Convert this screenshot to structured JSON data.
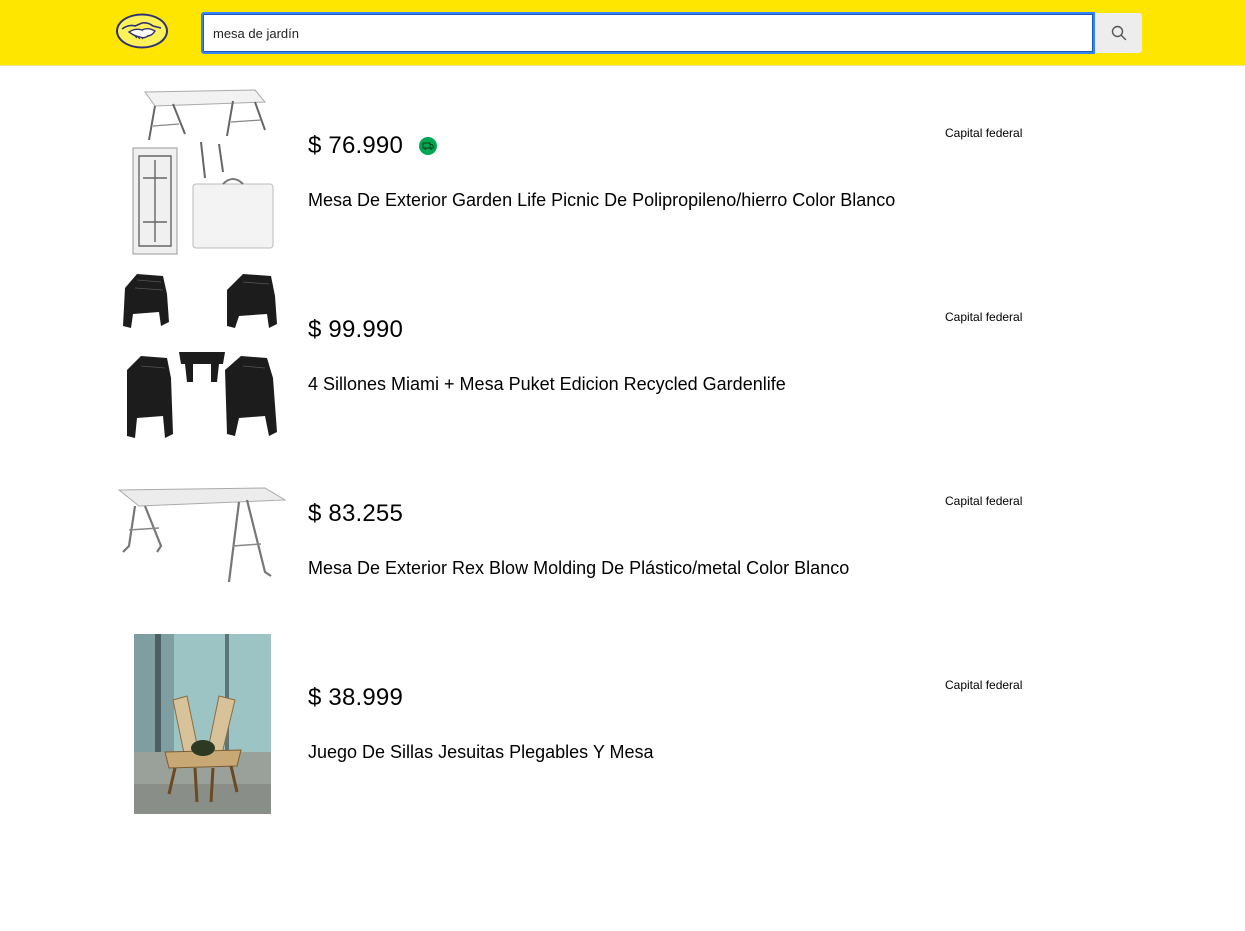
{
  "header": {
    "logo_icon": "mercadolibre-handshake-logo",
    "search": {
      "value": "mesa de jardín",
      "placeholder": "",
      "button_icon": "search-icon"
    },
    "colors": {
      "brand_yellow": "#ffe600",
      "focus_blue": "#3483fa"
    }
  },
  "results": [
    {
      "price": "$ 76.990",
      "title": "Mesa De Exterior Garden Life Picnic De Polipropileno/hierro Color Blanco",
      "location": "Capital federal",
      "badge_icon": "free-shipping-icon",
      "image_icon": "folding-table-image"
    },
    {
      "price": "$ 99.990",
      "title": "4 Sillones Miami + Mesa Puket Edicion Recycled Gardenlife",
      "location": "Capital federal",
      "image_icon": "black-chairs-table-set-image"
    },
    {
      "price": "$ 83.255",
      "title": "Mesa De Exterior Rex Blow Molding De Plástico/metal Color Blanco",
      "location": "Capital federal",
      "image_icon": "folding-table-image"
    },
    {
      "price": "$ 38.999",
      "title": "Juego De Sillas Jesuitas Plegables Y Mesa",
      "location": "Capital federal",
      "image_icon": "wooden-chairs-photo"
    }
  ]
}
